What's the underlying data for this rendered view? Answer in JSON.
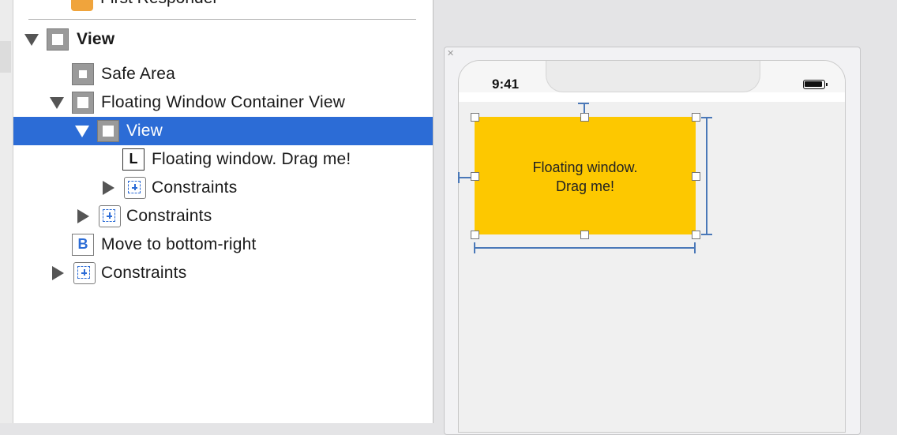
{
  "outline": {
    "partial_top_item": "First Responder",
    "items": [
      {
        "label": "View",
        "bold": true
      },
      {
        "label": "Safe Area"
      },
      {
        "label": "Floating Window Container View"
      },
      {
        "label": "View",
        "selected": true
      },
      {
        "label": "Floating window. Drag me!"
      },
      {
        "label": "Constraints"
      },
      {
        "label": "Constraints"
      },
      {
        "label": "Move to bottom-right"
      },
      {
        "label": "Constraints"
      }
    ],
    "icons": {
      "label_glyph": "L",
      "button_glyph": "B"
    }
  },
  "canvas": {
    "status_time": "9:41",
    "floating_window_text_line1": "Floating window.",
    "floating_window_text_line2": "Drag me!"
  },
  "colors": {
    "selection": "#2c6cd6",
    "floating_window": "#fdc800",
    "constraint_guide": "#4a78b8"
  }
}
